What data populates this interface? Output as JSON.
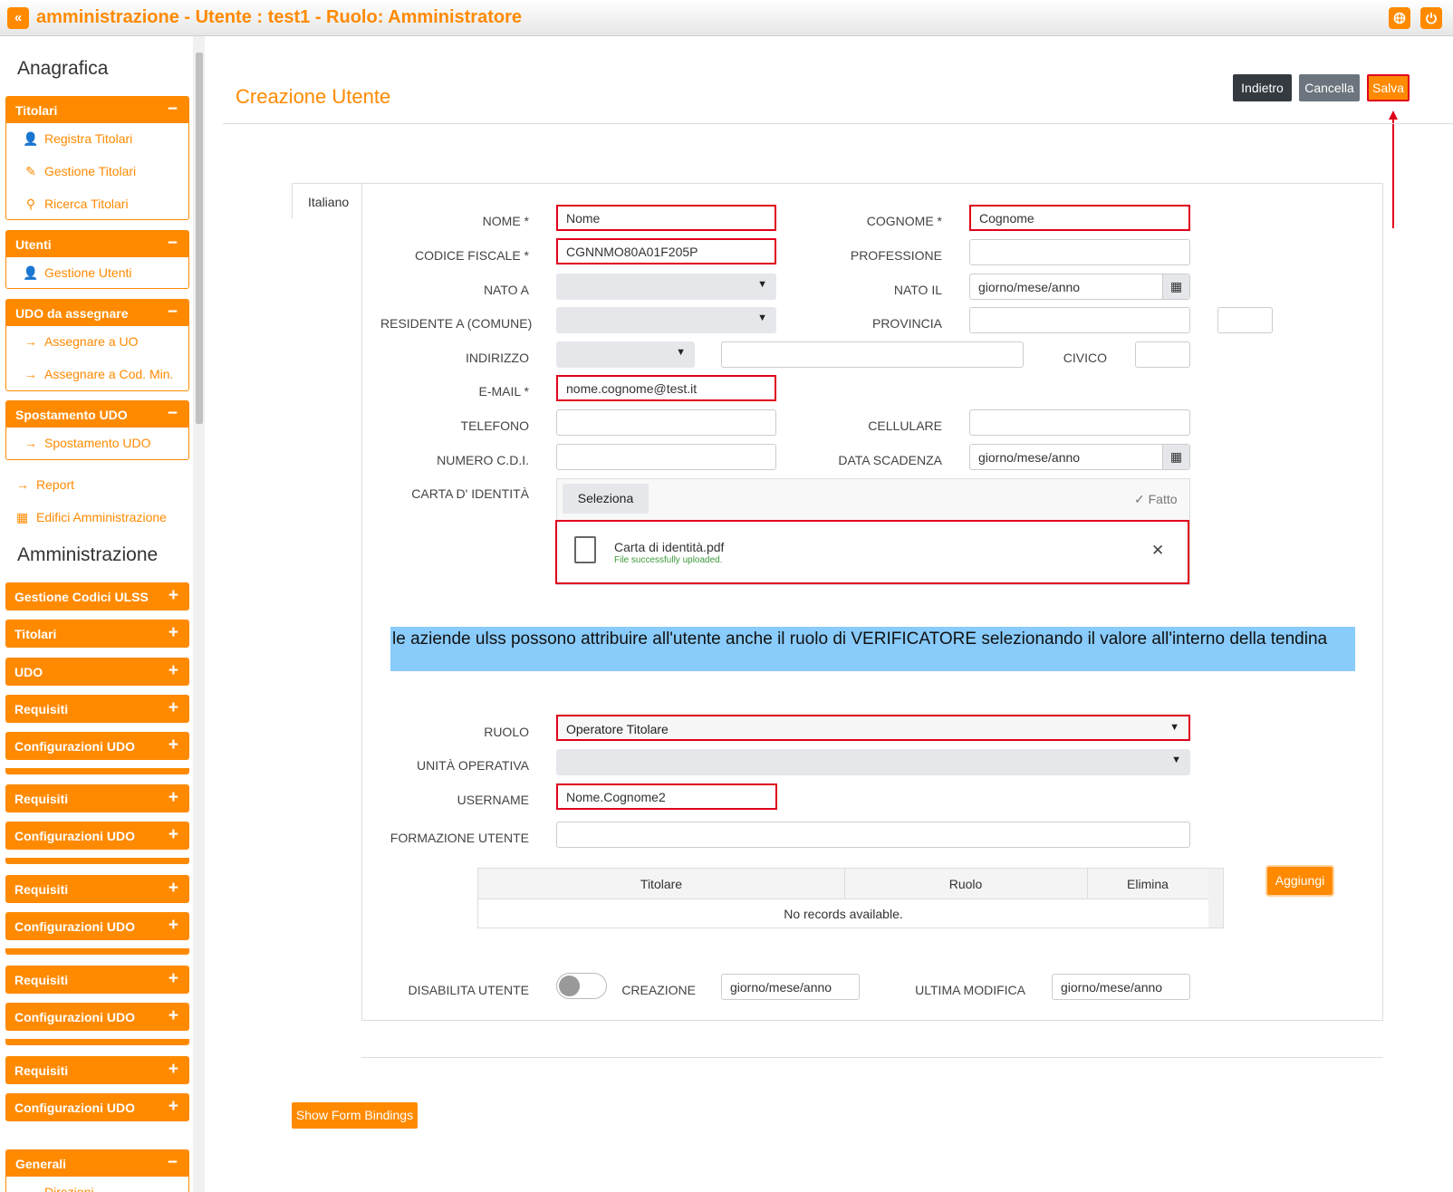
{
  "app": {
    "title": "amministrazione - Utente : test1 - Ruolo: Amministratore",
    "back_icon": "«"
  },
  "sidebar": {
    "anagrafica_title": "Anagrafica",
    "titolari": {
      "label": "Titolari",
      "items": [
        "Registra Titolari",
        "Gestione Titolari",
        "Ricerca Titolari"
      ]
    },
    "utenti": {
      "label": "Utenti",
      "items": [
        "Gestione Utenti"
      ]
    },
    "udo_assegnare": {
      "label": "UDO da assegnare",
      "items": [
        "Assegnare a UO",
        "Assegnare a Cod. Min."
      ]
    },
    "spostamento": {
      "label": "Spostamento UDO",
      "items": [
        "Spostamento UDO"
      ]
    },
    "report": "Report",
    "edifici": "Edifici Amministrazione",
    "amministrazione_title": "Amministrazione",
    "collapsed": [
      "Gestione Codici ULSS",
      "Titolari",
      "UDO",
      "Requisiti",
      "Configurazioni UDO",
      "Requisiti",
      "Configurazioni UDO",
      "Requisiti",
      "Configurazioni UDO",
      "Requisiti",
      "Configurazioni UDO",
      "Requisiti",
      "Configurazioni UDO"
    ],
    "generali": {
      "label": "Generali",
      "items": [
        "Direzioni"
      ]
    }
  },
  "header": {
    "title": "Creazione Utente",
    "back_label": "Indietro",
    "cancel_label": "Cancella",
    "save_label": "Salva"
  },
  "tab": {
    "label": "Italiano"
  },
  "form": {
    "nome": {
      "label": "NOME *",
      "value": "Nome"
    },
    "cognome": {
      "label": "COGNOME *",
      "value": "Cognome"
    },
    "codice_fiscale": {
      "label": "CODICE FISCALE *",
      "value": "CGNNMO80A01F205P"
    },
    "professione": {
      "label": "PROFESSIONE",
      "value": ""
    },
    "nato_a": {
      "label": "NATO A",
      "value": ""
    },
    "nato_il": {
      "label": "NATO IL",
      "value": "giorno/mese/anno"
    },
    "residente": {
      "label": "RESIDENTE A (COMUNE)",
      "value": ""
    },
    "provincia": {
      "label": "PROVINCIA",
      "value": ""
    },
    "indirizzo": {
      "label": "INDIRIZZO",
      "value": ""
    },
    "civico": {
      "label": "CIVICO",
      "value": ""
    },
    "email": {
      "label": "E-MAIL *",
      "value": "nome.cognome@test.it"
    },
    "telefono": {
      "label": "TELEFONO",
      "value": ""
    },
    "cellulare": {
      "label": "CELLULARE",
      "value": ""
    },
    "numero_cdi": {
      "label": "NUMERO C.D.I.",
      "value": ""
    },
    "data_scadenza": {
      "label": "DATA SCADENZA",
      "value": "giorno/mese/anno"
    },
    "carta": {
      "label": "CARTA D' IDENTITÀ",
      "select_label": "Seleziona",
      "done_label": "Fatto",
      "file_name": "Carta di identità.pdf",
      "file_status": "File successfully uploaded."
    },
    "ruolo": {
      "label": "RUOLO",
      "value": "Operatore Titolare"
    },
    "unita": {
      "label": "UNITÀ OPERATIVA",
      "value": ""
    },
    "username": {
      "label": "USERNAME",
      "value": "Nome.Cognome2"
    },
    "formazione": {
      "label": "FORMAZIONE UTENTE",
      "value": ""
    },
    "disabilita": {
      "label": "DISABILITA UTENTE",
      "enabled": false
    },
    "creazione": {
      "label": "CREAZIONE",
      "value": "giorno/mese/anno"
    },
    "ultima_modifica": {
      "label": "ULTIMA MODIFICA",
      "value": "giorno/mese/anno"
    }
  },
  "note": "le aziende ulss possono attribuire all'utente anche il ruolo di VERIFICATORE selezionando il valore all'interno della tendina",
  "grid": {
    "columns": [
      "Titolare",
      "Ruolo",
      "Elimina"
    ],
    "empty": "No records available.",
    "add_label": "Aggiungi"
  },
  "footer": {
    "show_bindings_label": "Show Form Bindings"
  },
  "colors": {
    "accent": "#ff8a00",
    "highlight": "#e0001b",
    "note_bg": "#89cbfb"
  }
}
